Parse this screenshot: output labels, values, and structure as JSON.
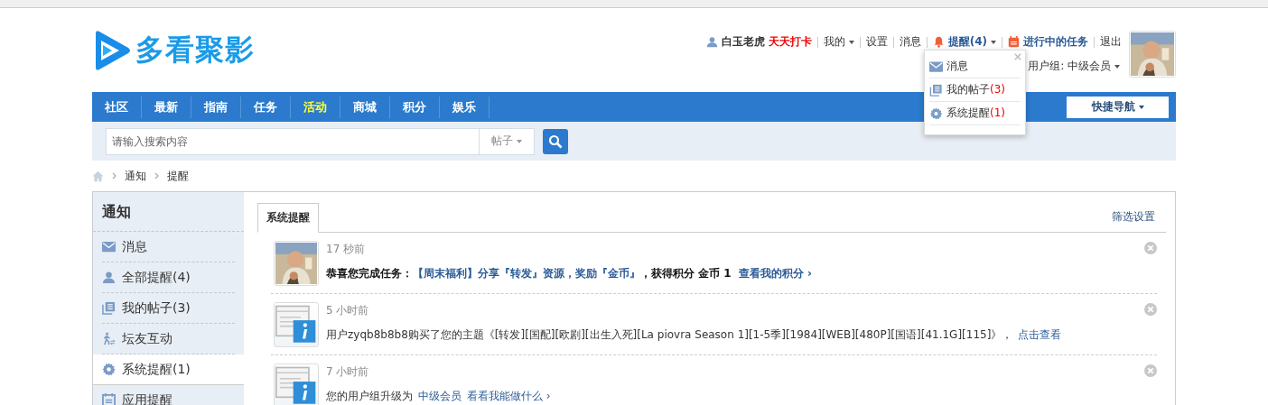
{
  "logo": {
    "text": "多看聚影"
  },
  "user_bar": {
    "username": "白玉老虎",
    "checkin": "天天打卡",
    "links": [
      {
        "label": "我的",
        "dropdown": true
      },
      {
        "label": "设置",
        "dropdown": false
      },
      {
        "label": "消息",
        "dropdown": false
      }
    ],
    "reminder": "提醒(4)",
    "tasks": "进行中的任务",
    "logout": "退出",
    "user_group": "用户组: 中级会员"
  },
  "reminder_menu": {
    "items": [
      {
        "kind": "mail",
        "label": "消息"
      },
      {
        "kind": "posts",
        "label": "我的帖子",
        "count": "(3)"
      },
      {
        "kind": "gear",
        "label": "系统提醒",
        "count": "(1)"
      }
    ]
  },
  "nav": {
    "items": [
      {
        "label": "社区",
        "highlight": false
      },
      {
        "label": "最新",
        "highlight": false
      },
      {
        "label": "指南",
        "highlight": false
      },
      {
        "label": "任务",
        "highlight": false
      },
      {
        "label": "活动",
        "highlight": true
      },
      {
        "label": "商城",
        "highlight": false
      },
      {
        "label": "积分",
        "highlight": false
      },
      {
        "label": "娱乐",
        "highlight": false
      }
    ],
    "quick_nav": "快捷导航"
  },
  "search": {
    "placeholder": "请输入搜索内容",
    "scope": "帖子"
  },
  "breadcrumb": [
    "通知",
    "提醒"
  ],
  "sidebar": {
    "title": "通知",
    "items": [
      {
        "kind": "mail",
        "label": "消息",
        "selected": false
      },
      {
        "kind": "user",
        "label": "全部提醒(4)",
        "selected": false
      },
      {
        "kind": "posts",
        "label": "我的帖子(3)",
        "selected": false
      },
      {
        "kind": "walk",
        "label": "坛友互动",
        "selected": false
      },
      {
        "kind": "gear",
        "label": "系统提醒(1)",
        "selected": true
      },
      {
        "kind": "calendar",
        "label": "应用提醒",
        "selected": false
      }
    ]
  },
  "tabs": [
    {
      "label": "系统提醒",
      "selected": true
    }
  ],
  "filter_link": "筛选设置",
  "notifications": [
    {
      "kind": "picture",
      "time": "17 秒前",
      "parts": [
        {
          "kind": "bold",
          "text": "恭喜您完成任务："
        },
        {
          "kind": "link",
          "text": "【周末福利】分享『转发』资源，奖励『金币』"
        },
        {
          "kind": "bold",
          "text": "，获得积分 金币 1"
        },
        {
          "kind": "link",
          "text": "查看我的积分 ›"
        }
      ]
    },
    {
      "kind": "info",
      "time": "5 小时前",
      "parts": [
        {
          "kind": "plain",
          "text": "用户zyqb8b8b8购买了您的主题《[转发][国配][欧剧][出生入死][La piovra Season 1][1-5季][1984][WEB][480P][国语][41.1G][115]》，"
        },
        {
          "kind": "link",
          "text": "点击查看"
        }
      ]
    },
    {
      "kind": "info",
      "time": "7 小时前",
      "parts": [
        {
          "kind": "plain",
          "text": "您的用户组升级为"
        },
        {
          "kind": "link",
          "text": "中级会员"
        },
        {
          "kind": "link",
          "text": "看看我能做什么 ›"
        }
      ]
    }
  ]
}
